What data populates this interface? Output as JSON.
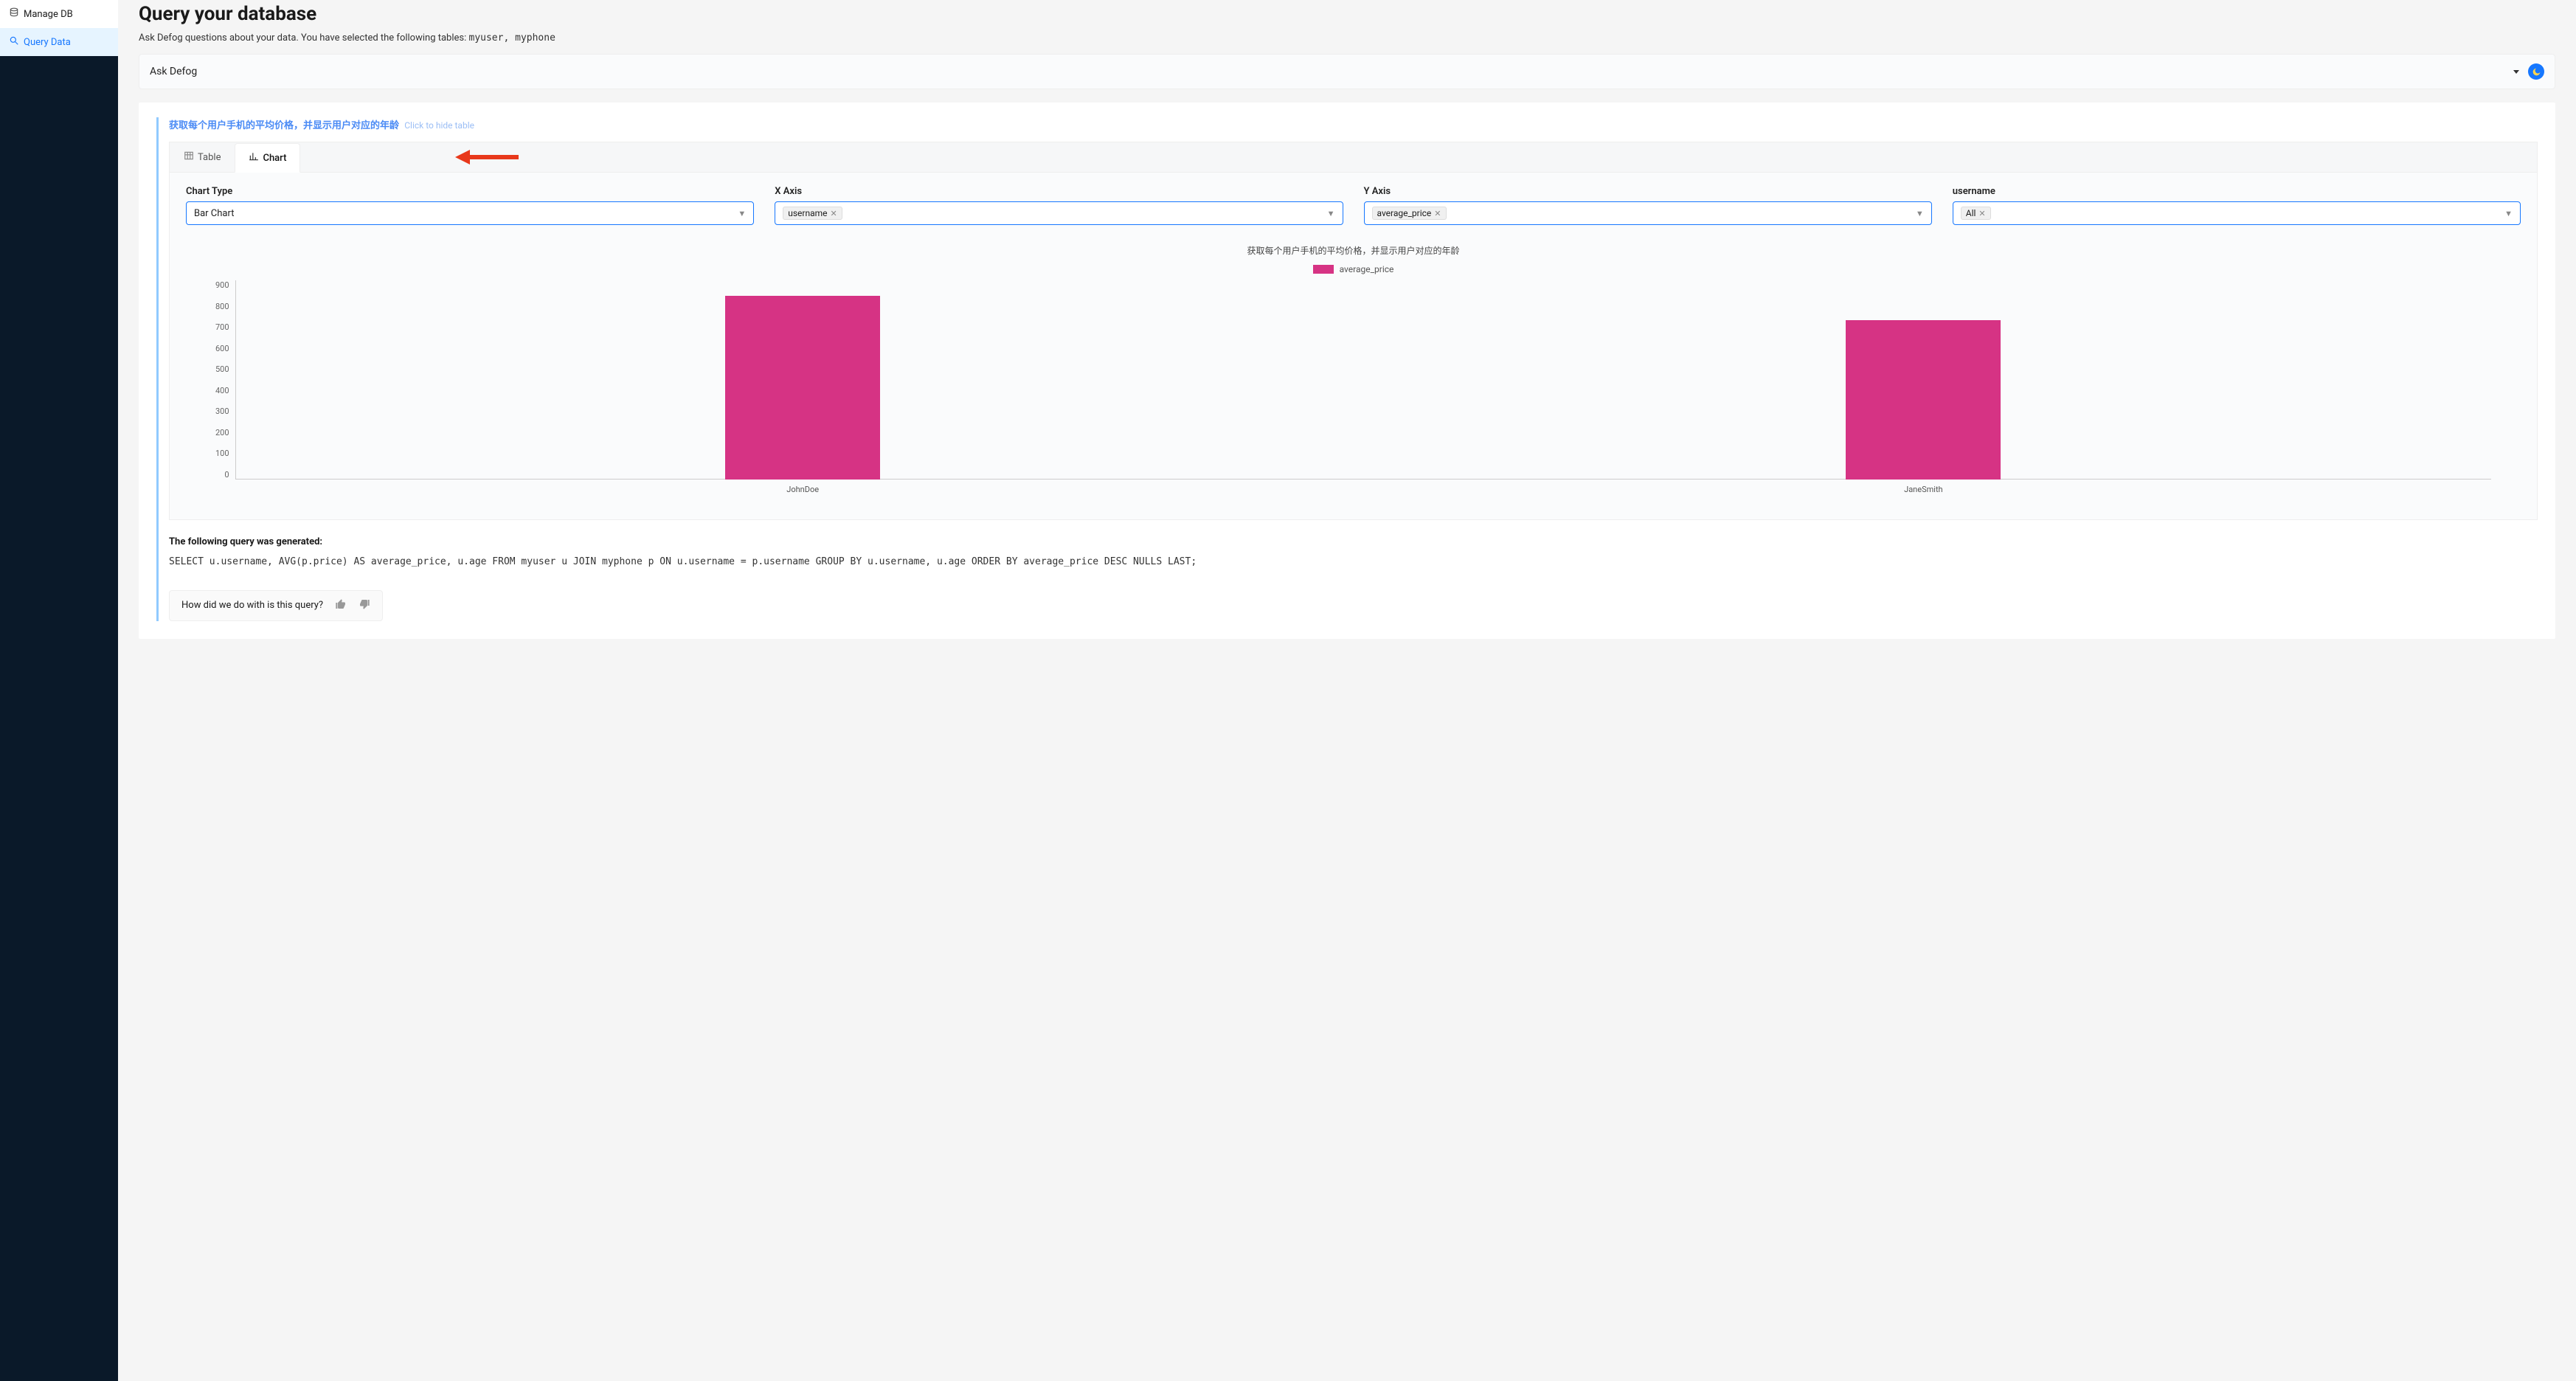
{
  "sidebar": {
    "items": [
      {
        "label": "Manage DB",
        "icon": "database-icon"
      },
      {
        "label": "Query Data",
        "icon": "search-icon"
      }
    ]
  },
  "header": {
    "title": "Query your database",
    "subtitle_prefix": "Ask Defog questions about your data. You have selected the following tables: ",
    "tables": "myuser, myphone",
    "ask_label": "Ask Defog"
  },
  "result": {
    "question": "获取每个用户手机的平均价格，并显示用户对应的年龄",
    "hide_link": "Click to hide table",
    "tabs": {
      "table": "Table",
      "chart": "Chart"
    },
    "controls": {
      "chart_type": {
        "label": "Chart Type",
        "value": "Bar Chart"
      },
      "x_axis": {
        "label": "X Axis",
        "chip": "username"
      },
      "y_axis": {
        "label": "Y Axis",
        "chip": "average_price"
      },
      "username": {
        "label": "username",
        "chip": "All"
      }
    },
    "query_heading": "The following query was generated:",
    "query_sql": "SELECT u.username, AVG(p.price) AS average_price, u.age FROM myuser u JOIN myphone p ON u.username = p.username GROUP BY u.username, u.age ORDER BY average_price DESC NULLS LAST;",
    "feedback_prompt": "How did we do with is this query?"
  },
  "chart_data": {
    "type": "bar",
    "title": "获取每个用户手机的平均价格，并显示用户对应的年龄",
    "legend": "average_price",
    "categories": [
      "JohnDoe",
      "JaneSmith"
    ],
    "values": [
      830,
      720
    ],
    "xlabel": "",
    "ylabel": "",
    "ylim": [
      0,
      900
    ],
    "yticks": [
      0,
      100,
      200,
      300,
      400,
      500,
      600,
      700,
      800,
      900
    ]
  }
}
